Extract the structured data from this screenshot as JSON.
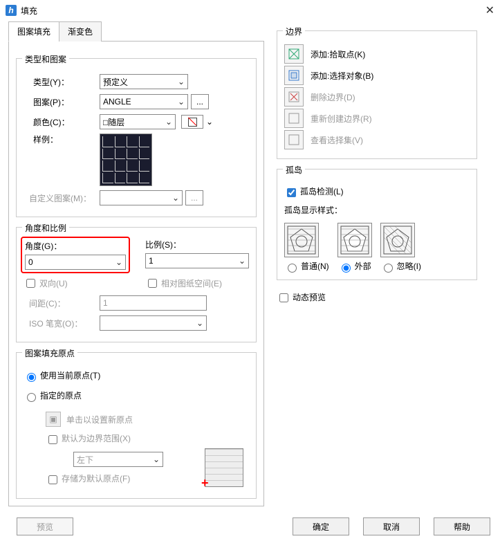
{
  "title": "填充",
  "tabs": {
    "pattern": "图案填充",
    "gradient": "渐变色"
  },
  "type_group": {
    "title": "类型和图案",
    "type_lbl": "类型(Y)：",
    "type_val": "预定义",
    "pattern_lbl": "图案(P)：",
    "pattern_val": "ANGLE",
    "color_lbl": "颜色(C)：",
    "color_val": "□随层",
    "sample_lbl": "样例：",
    "custom_lbl": "自定义图案(M)："
  },
  "angle_group": {
    "title": "角度和比例",
    "angle_lbl": "角度(G)：",
    "angle_val": "0",
    "scale_lbl": "比例(S)：",
    "scale_val": "1",
    "dbl_lbl": "双向(U)",
    "rel_lbl": "相对图纸空间(E)",
    "spacing_lbl": "间距(C)：",
    "spacing_val": "1",
    "iso_lbl": "ISO 笔宽(O)："
  },
  "origin_group": {
    "title": "图案填充原点",
    "use_current": "使用当前原点(T)",
    "specified": "指定的原点",
    "click_set": "单击以设置新原点",
    "default_bound": "默认为边界范围(X)",
    "pos_val": "左下",
    "store_default": "存储为默认原点(F)"
  },
  "boundary_group": {
    "title": "边界",
    "add_pick": "添加:拾取点(K)",
    "add_sel": "添加:选择对象(B)",
    "del": "删除边界(D)",
    "recreate": "重新创建边界(R)",
    "view_sel": "查看选择集(V)"
  },
  "island_group": {
    "title": "孤岛",
    "detect": "孤岛检测(L)",
    "style_lbl": "孤岛显示样式：",
    "normal": "普通(N)",
    "outer": "外部",
    "ignore": "忽略(I)"
  },
  "dynamic_preview": "动态预览",
  "buttons": {
    "preview": "预览",
    "ok": "确定",
    "cancel": "取消",
    "help": "帮助"
  },
  "dots": "..."
}
